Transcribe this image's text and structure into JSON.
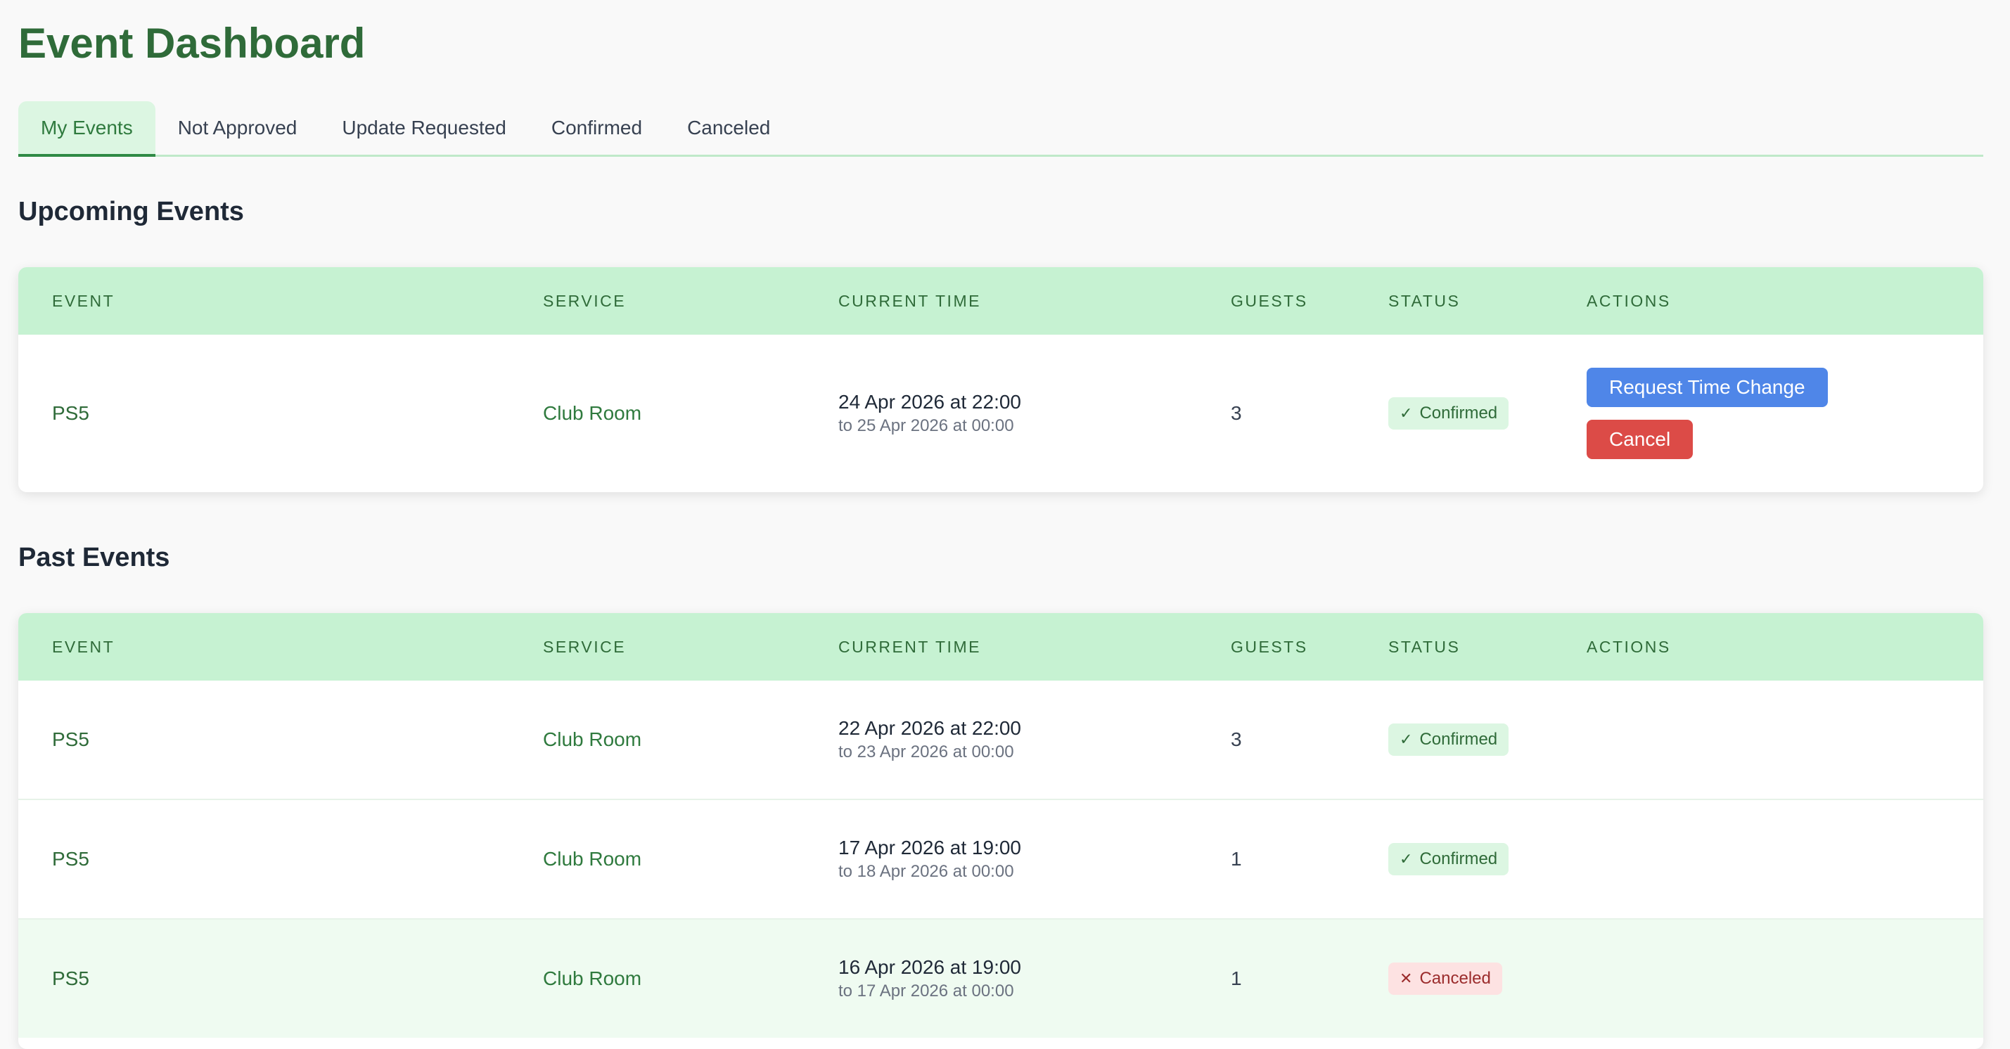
{
  "page": {
    "title": "Event Dashboard"
  },
  "tabs": [
    {
      "label": "My Events",
      "active": true
    },
    {
      "label": "Not Approved"
    },
    {
      "label": "Update Requested"
    },
    {
      "label": "Confirmed"
    },
    {
      "label": "Canceled"
    }
  ],
  "columns": [
    "EVENT",
    "SERVICE",
    "CURRENT TIME",
    "GUESTS",
    "STATUS",
    "ACTIONS"
  ],
  "upcoming": {
    "title": "Upcoming Events",
    "rows": [
      {
        "event": "PS5",
        "service": "Club Room",
        "time_main": "24 Apr 2026 at 22:00",
        "time_sub": "to 25 Apr 2026 at 00:00",
        "guests": "3",
        "status": "Confirmed",
        "status_icon": "check-icon",
        "actions": {
          "request_label": "Request Time Change",
          "cancel_label": "Cancel"
        }
      }
    ]
  },
  "past": {
    "title": "Past Events",
    "rows": [
      {
        "event": "PS5",
        "service": "Club Room",
        "time_main": "22 Apr 2026 at 22:00",
        "time_sub": "to 23 Apr 2026 at 00:00",
        "guests": "3",
        "status": "Confirmed",
        "status_icon": "check-icon"
      },
      {
        "event": "PS5",
        "service": "Club Room",
        "time_main": "17 Apr 2026 at 19:00",
        "time_sub": "to 18 Apr 2026 at 00:00",
        "guests": "1",
        "status": "Confirmed",
        "status_icon": "check-icon"
      },
      {
        "event": "PS5",
        "service": "Club Room",
        "time_main": "16 Apr 2026 at 19:00",
        "time_sub": "to 17 Apr 2026 at 00:00",
        "guests": "1",
        "status": "Canceled",
        "status_icon": "x-icon"
      }
    ]
  },
  "colors": {
    "brand_green": "#2f6b39",
    "header_bg": "#c6f2d2",
    "primary_button": "#4f86e8",
    "danger_button": "#dc4b47",
    "confirmed_badge": "#dcf6e2",
    "canceled_badge": "#fde2e2"
  }
}
